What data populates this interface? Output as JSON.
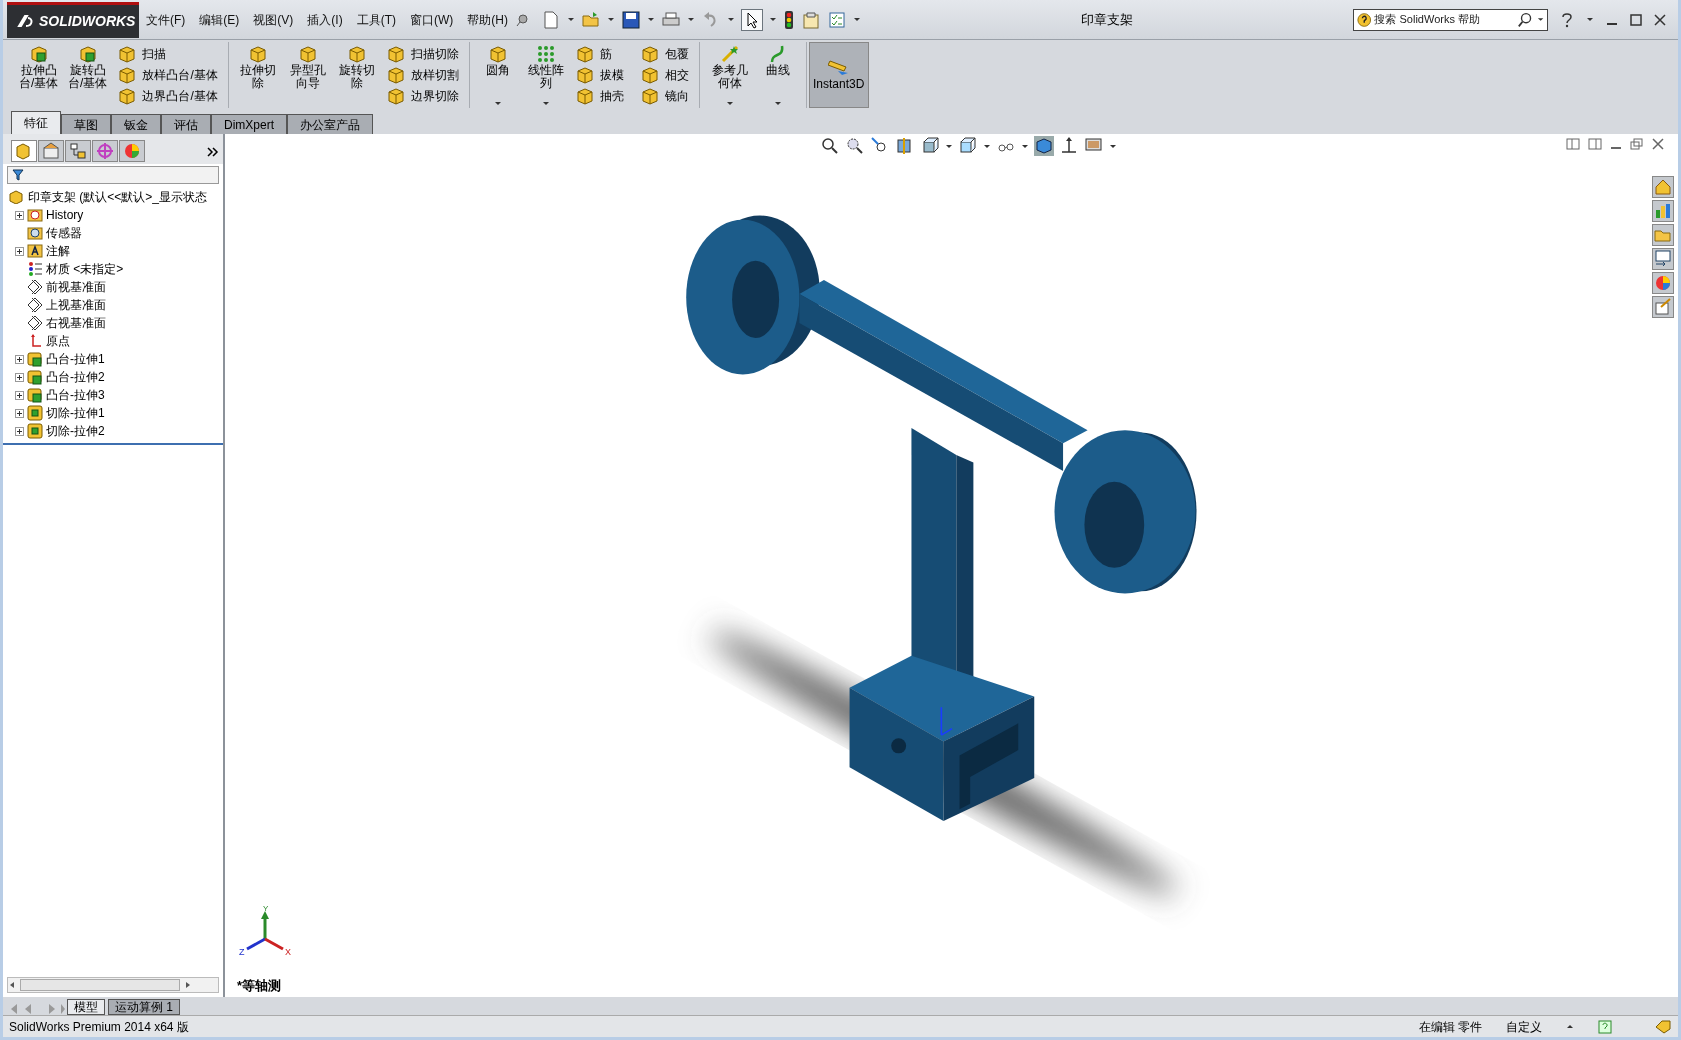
{
  "app": {
    "logo": "SOLIDWORKS"
  },
  "menu": [
    "文件(F)",
    "编辑(E)",
    "视图(V)",
    "插入(I)",
    "工具(T)",
    "窗口(W)",
    "帮助(H)"
  ],
  "window": {
    "title": "印章支架"
  },
  "search": {
    "placeholder": "搜索 SolidWorks 帮助"
  },
  "ribbon": [
    {
      "big": [
        {
          "label": "拉伸凸台/基体",
          "dropdown": false
        },
        {
          "label": "旋转凸台/基体",
          "dropdown": false
        }
      ],
      "small": [
        [
          "扫描",
          "放样凸台/基体",
          "边界凸台/基体"
        ]
      ]
    },
    {
      "big": [
        {
          "label": "拉伸切除",
          "dropdown": false
        },
        {
          "label": "异型孔向导",
          "dropdown": false
        },
        {
          "label": "旋转切除",
          "dropdown": false
        }
      ],
      "small": [
        [
          "扫描切除",
          "放样切割",
          "边界切除"
        ]
      ]
    },
    {
      "big": [
        {
          "label": "圆角",
          "dropdown": true
        },
        {
          "label": "线性阵列",
          "dropdown": true
        }
      ],
      "small": [
        [
          "筋",
          "拔模",
          "抽壳"
        ],
        [
          "包覆",
          "相交",
          "镜向"
        ]
      ]
    },
    {
      "big": [
        {
          "label": "参考几何体",
          "dropdown": true
        },
        {
          "label": "曲线",
          "dropdown": true
        }
      ]
    }
  ],
  "instant3d": {
    "label": "Instant3D",
    "on": true
  },
  "command_tabs": [
    {
      "label": "特征",
      "selected": true
    },
    {
      "label": "草图",
      "selected": false
    },
    {
      "label": "钣金",
      "selected": false
    },
    {
      "label": "评估",
      "selected": false
    },
    {
      "label": "DimXpert",
      "selected": false
    },
    {
      "label": "办公室产品",
      "selected": false
    }
  ],
  "panel_tabs": [
    {
      "selected": true
    },
    {
      "selected": false
    },
    {
      "selected": false
    },
    {
      "selected": false
    },
    {
      "selected": false
    }
  ],
  "tree": {
    "root": "印章支架  (默认<<默认>_显示状态",
    "items": [
      {
        "label": "History",
        "expanded": false
      },
      {
        "label": "传感器"
      },
      {
        "label": "注解",
        "expanded": false
      },
      {
        "label": "材质 <未指定>"
      },
      {
        "label": "前视基准面"
      },
      {
        "label": "上视基准面"
      },
      {
        "label": "右视基准面"
      },
      {
        "label": "原点"
      },
      {
        "label": "凸台-拉伸1",
        "expanded": false
      },
      {
        "label": "凸台-拉伸2",
        "expanded": false
      },
      {
        "label": "凸台-拉伸3",
        "expanded": false
      },
      {
        "label": "切除-拉伸1",
        "expanded": false
      },
      {
        "label": "切除-拉伸2",
        "expanded": false
      }
    ]
  },
  "viewport": {
    "view_name": "*等轴测",
    "axes": [
      "Y",
      "Z",
      "X"
    ]
  },
  "bottom_tabs": [
    {
      "label": "模型",
      "selected": true
    },
    {
      "label": "运动算例 1",
      "selected": false
    }
  ],
  "status_bar": {
    "product": "SolidWorks Premium 2014 x64 版",
    "mode": "在编辑 零件",
    "units": "自定义"
  }
}
